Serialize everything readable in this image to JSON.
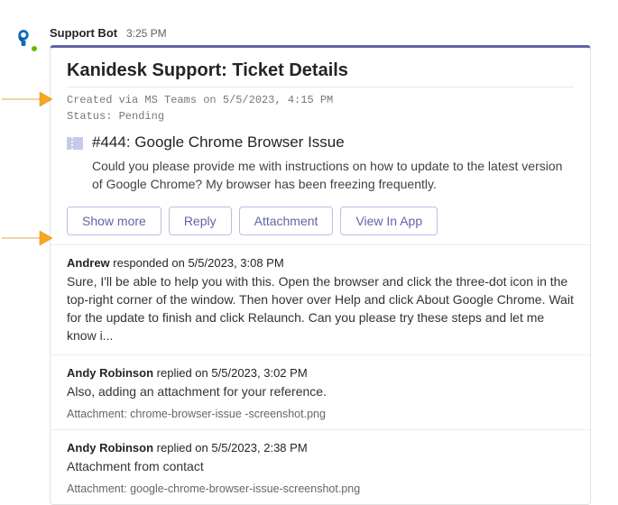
{
  "sender": {
    "name": "Support Bot",
    "time": "3:25 PM"
  },
  "card": {
    "title": "Kanidesk Support: Ticket Details",
    "meta_line1": "Created via MS Teams on 5/5/2023, 4:15 PM",
    "meta_line2": "Status: Pending",
    "ticket_title": "#444: Google Chrome Browser Issue",
    "ticket_body": "Could you please provide me with instructions on how to update to the latest version of Google Chrome? My browser has been freezing frequently.",
    "buttons": {
      "show_more": "Show more",
      "reply": "Reply",
      "attachment": "Attachment",
      "view_in_app": "View In App"
    }
  },
  "replies": [
    {
      "author": "Andrew",
      "verb": "responded on",
      "when": "5/5/2023, 3:08 PM",
      "body": "Sure, I'll be able to help you with this. Open the browser and click the three-dot icon in the top-right corner of the window. Then hover over Help and click About Google Chrome. Wait for the update to finish and click Relaunch. Can you please try these steps and let me know i...",
      "attachment": ""
    },
    {
      "author": "Andy Robinson",
      "verb": "replied on",
      "when": "5/5/2023, 3:02 PM",
      "body": "Also, adding an attachment for your reference.",
      "attachment": "Attachment: chrome-browser-issue -screenshot.png"
    },
    {
      "author": "Andy Robinson",
      "verb": "replied on",
      "when": "5/5/2023, 2:38 PM",
      "body": "Attachment from contact",
      "attachment": "Attachment: google-chrome-browser-issue-screenshot.png"
    }
  ]
}
